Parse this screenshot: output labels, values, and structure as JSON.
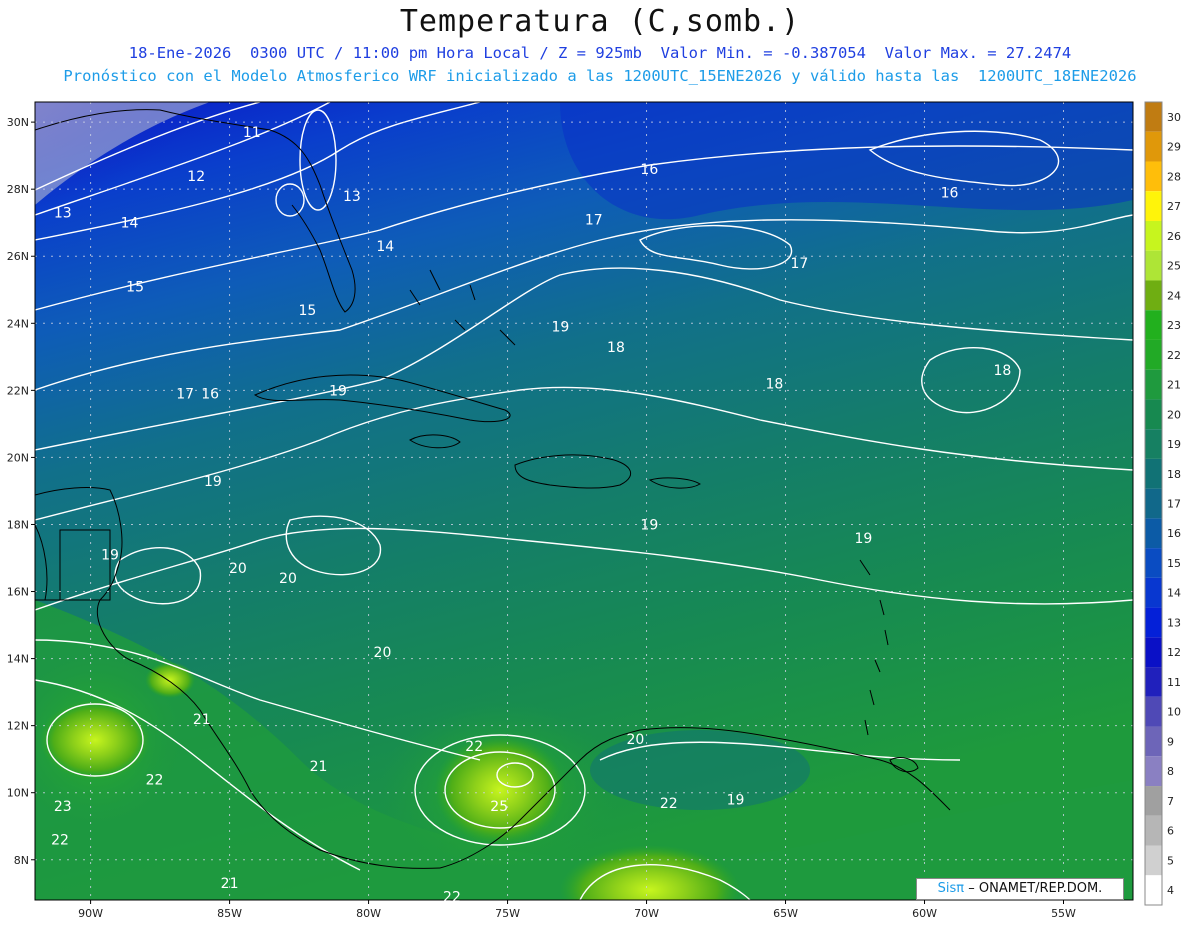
{
  "header": {
    "title": "Temperatura (C,somb.)",
    "line1": "18-Ene-2026  0300 UTC / 11:00 pm Hora Local / Z = 925mb  Valor Min. = -0.387054  Valor Max. = 27.2474",
    "line2": "Pronóstico con el Modelo Atmosferico WRF inicializado a las 1200UTC_15ENE2026 y válido hasta las  1200UTC_18ENE2026"
  },
  "map": {
    "lon_range": [
      -92,
      -52.5
    ],
    "lat_range": [
      6.8,
      30.6
    ],
    "lat_labels": [
      "30N",
      "28N",
      "26N",
      "24N",
      "22N",
      "20N",
      "18N",
      "16N",
      "14N",
      "12N",
      "10N",
      "8N"
    ],
    "lat_values": [
      30,
      28,
      26,
      24,
      22,
      20,
      18,
      16,
      14,
      12,
      10,
      8
    ],
    "lon_labels": [
      "90W",
      "85W",
      "80W",
      "75W",
      "70W",
      "65W",
      "60W",
      "55W"
    ],
    "lon_values": [
      -90,
      -85,
      -80,
      -75,
      -70,
      -65,
      -60,
      -55
    ],
    "contour_labels": [
      {
        "text": "11",
        "lon": -84.2,
        "lat": 29.7
      },
      {
        "text": "12",
        "lon": -86.2,
        "lat": 28.4
      },
      {
        "text": "13",
        "lon": -91.0,
        "lat": 27.3
      },
      {
        "text": "14",
        "lon": -88.6,
        "lat": 27.0
      },
      {
        "text": "13",
        "lon": -80.6,
        "lat": 27.8
      },
      {
        "text": "14",
        "lon": -79.4,
        "lat": 26.3
      },
      {
        "text": "15",
        "lon": -88.4,
        "lat": 25.1
      },
      {
        "text": "15",
        "lon": -82.2,
        "lat": 24.4
      },
      {
        "text": "16",
        "lon": -69.9,
        "lat": 28.6
      },
      {
        "text": "17",
        "lon": -71.9,
        "lat": 27.1
      },
      {
        "text": "16",
        "lon": -59.1,
        "lat": 27.9
      },
      {
        "text": "17",
        "lon": -64.5,
        "lat": 25.8
      },
      {
        "text": "19",
        "lon": -73.1,
        "lat": 23.9
      },
      {
        "text": "18",
        "lon": -71.1,
        "lat": 23.3
      },
      {
        "text": "17",
        "lon": -86.6,
        "lat": 21.9
      },
      {
        "text": "16",
        "lon": -85.7,
        "lat": 21.9
      },
      {
        "text": "19",
        "lon": -81.1,
        "lat": 22.0
      },
      {
        "text": "18",
        "lon": -65.4,
        "lat": 22.2
      },
      {
        "text": "18",
        "lon": -57.2,
        "lat": 22.6
      },
      {
        "text": "19",
        "lon": -85.6,
        "lat": 19.3
      },
      {
        "text": "19",
        "lon": -69.9,
        "lat": 18.0
      },
      {
        "text": "19",
        "lon": -62.2,
        "lat": 17.6
      },
      {
        "text": "19",
        "lon": -89.3,
        "lat": 17.1
      },
      {
        "text": "20",
        "lon": -84.7,
        "lat": 16.7
      },
      {
        "text": "20",
        "lon": -82.9,
        "lat": 16.4
      },
      {
        "text": "20",
        "lon": -79.5,
        "lat": 14.2
      },
      {
        "text": "21",
        "lon": -86.0,
        "lat": 12.2
      },
      {
        "text": "21",
        "lon": -81.8,
        "lat": 10.8
      },
      {
        "text": "22",
        "lon": -76.2,
        "lat": 11.4
      },
      {
        "text": "20",
        "lon": -70.4,
        "lat": 11.6
      },
      {
        "text": "22",
        "lon": -87.7,
        "lat": 10.4
      },
      {
        "text": "23",
        "lon": -91.0,
        "lat": 9.6
      },
      {
        "text": "25",
        "lon": -75.3,
        "lat": 9.6
      },
      {
        "text": "22",
        "lon": -69.2,
        "lat": 9.7
      },
      {
        "text": "19",
        "lon": -66.8,
        "lat": 9.8
      },
      {
        "text": "22",
        "lon": -91.1,
        "lat": 8.6
      },
      {
        "text": "21",
        "lon": -85.0,
        "lat": 7.3
      },
      {
        "text": "22",
        "lon": -77.0,
        "lat": 6.9
      }
    ]
  },
  "colorbar": {
    "labels": [
      "30",
      "29",
      "28",
      "27",
      "26",
      "25",
      "24",
      "23",
      "22",
      "21",
      "20",
      "19",
      "18",
      "17",
      "16",
      "15",
      "14",
      "13",
      "12",
      "11",
      "10",
      "9",
      "8",
      "7",
      "6",
      "5",
      "4"
    ],
    "colors": [
      "#c07c12",
      "#e0980a",
      "#ffbe0a",
      "#fff40a",
      "#c7f51e",
      "#aee536",
      "#6fae12",
      "#22b01e",
      "#22aa26",
      "#1f9a3e",
      "#178950",
      "#168062",
      "#117275",
      "#11688a",
      "#0c5ba6",
      "#0a4cc2",
      "#0837d0",
      "#0420d8",
      "#0a10c6",
      "#2020bc",
      "#4f49b6",
      "#6d65b8",
      "#8a80c2",
      "#a0a0a0",
      "#b6b6b6",
      "#d0d0d0",
      "#ffffff"
    ]
  },
  "credit": {
    "brand": "Sisπ",
    "org": "– ONAMET/REP.DOM."
  }
}
